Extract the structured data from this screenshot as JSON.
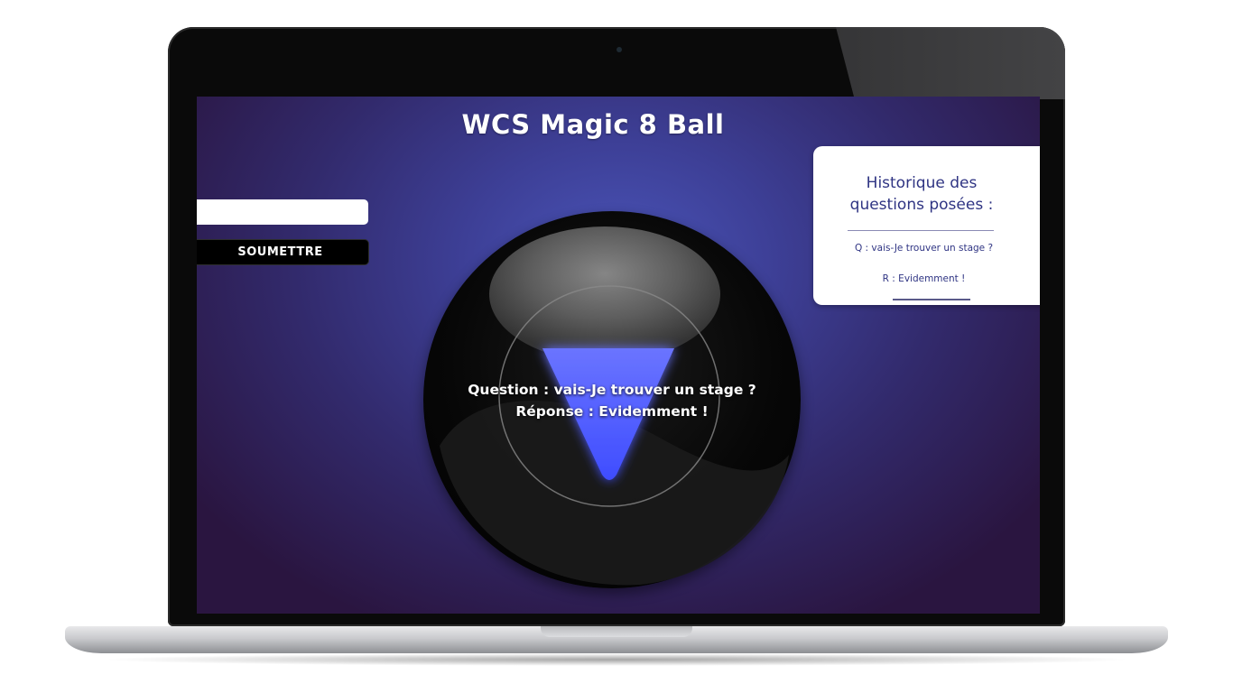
{
  "app": {
    "title": "WCS Magic 8 Ball"
  },
  "form": {
    "input_value": "",
    "input_placeholder": "",
    "submit_label": "SOUMETTRE"
  },
  "ball": {
    "question_line": "Question : vais-Je trouver un stage ?",
    "answer_line": "Réponse : Evidemment !"
  },
  "history": {
    "title": "Historique des questions posées :",
    "entries": [
      {
        "question": "Q : vais-Je trouver un stage ?",
        "answer": "R : Evidemment !"
      }
    ]
  },
  "colors": {
    "background_center": "#4a54b8",
    "background_edge": "#2a1540",
    "triangle": "#4f5cff",
    "history_text": "#2f3483",
    "button_bg": "#000000"
  }
}
